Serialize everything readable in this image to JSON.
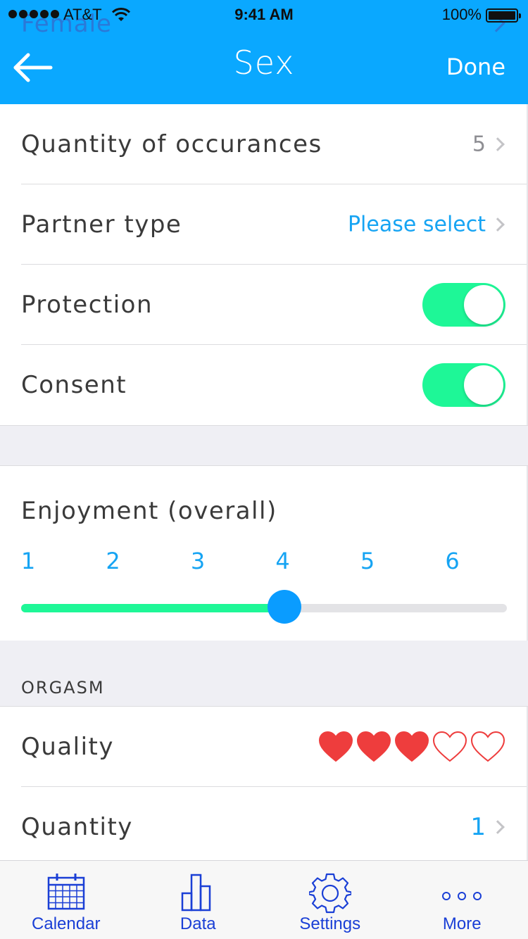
{
  "status_bar": {
    "carrier": "AT&T",
    "time": "9:41 AM",
    "battery": "100%"
  },
  "background_peek": {
    "text": "Female"
  },
  "nav": {
    "title": "Sex",
    "done_label": "Done"
  },
  "rows": {
    "quantity_occurrences": {
      "label": "Quantity of occurances",
      "value": "5"
    },
    "partner_type": {
      "label": "Partner type",
      "value": "Please select"
    },
    "protection": {
      "label": "Protection",
      "on": true
    },
    "consent": {
      "label": "Consent",
      "on": true
    }
  },
  "enjoyment": {
    "label": "Enjoyment (overall)",
    "scale": [
      "1",
      "2",
      "3",
      "4",
      "5",
      "6"
    ],
    "selected": 4
  },
  "orgasm": {
    "section_title": "ORGASM",
    "quality": {
      "label": "Quality",
      "rating": 3,
      "max": 5
    },
    "quantity": {
      "label": "Quantity",
      "value": "1"
    }
  },
  "tabbar": {
    "tabs": [
      {
        "label": "Calendar",
        "icon": "calendar-icon"
      },
      {
        "label": "Data",
        "icon": "bar-chart-icon"
      },
      {
        "label": "Settings",
        "icon": "gear-icon"
      },
      {
        "label": "More",
        "icon": "more-dots-icon"
      }
    ]
  },
  "colors": {
    "nav_blue": "#0aa8ff",
    "accent_blue": "#16a4f3",
    "toggle_green": "#1ef797",
    "heart_red": "#ee3d3d",
    "tab_blue": "#1a3fd6"
  }
}
